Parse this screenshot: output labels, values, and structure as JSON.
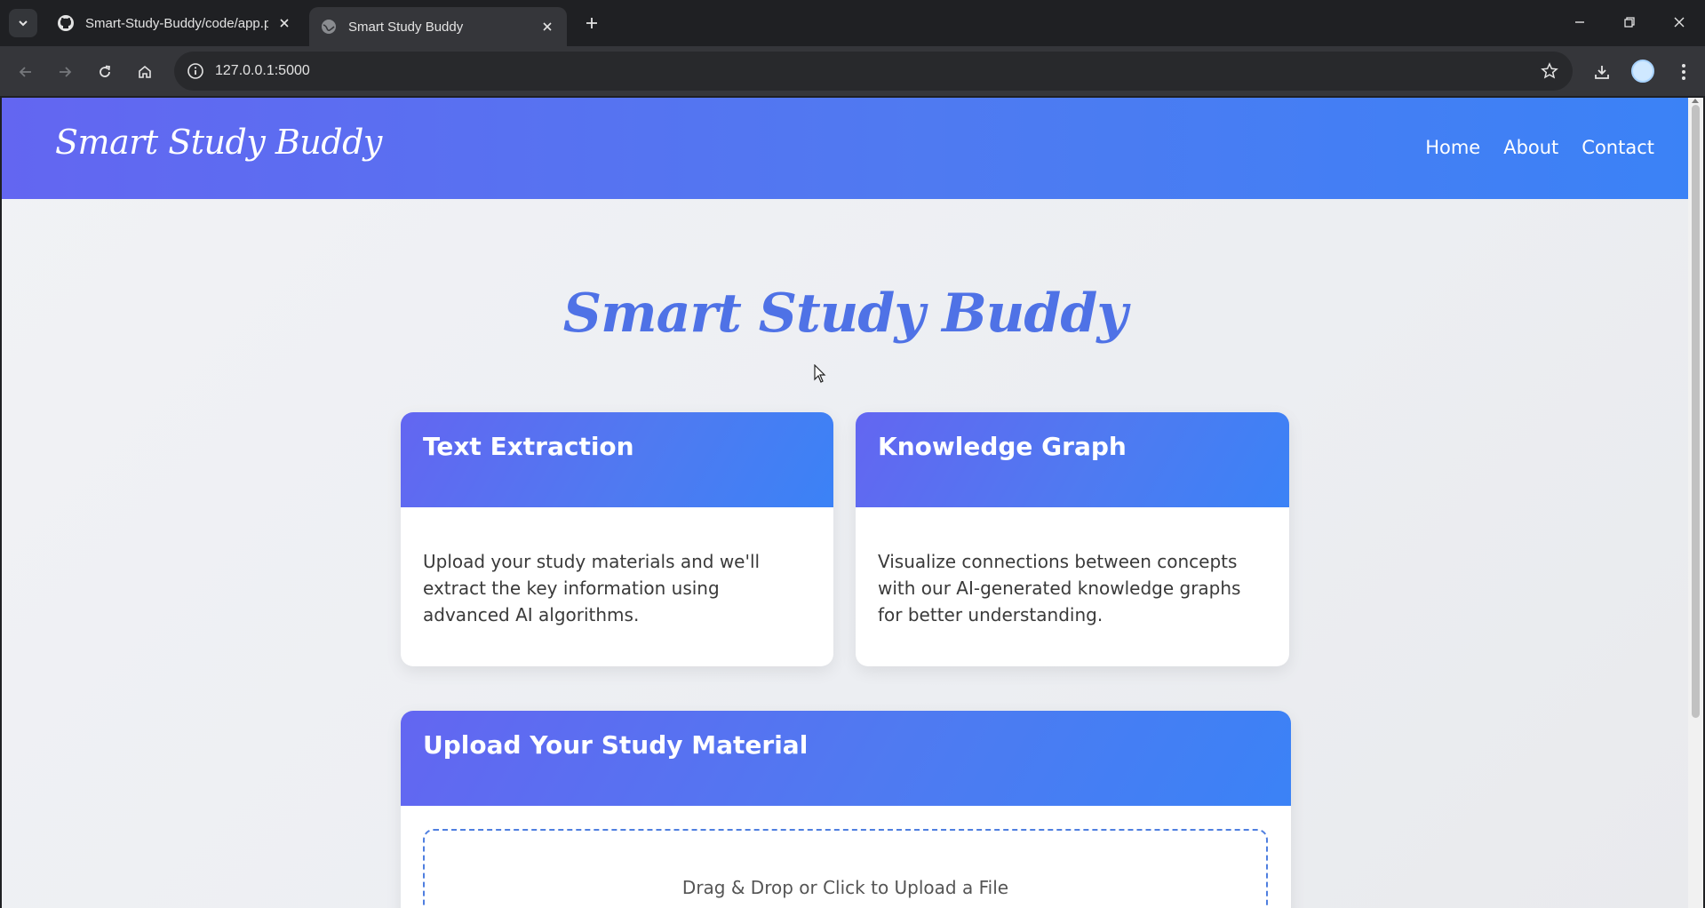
{
  "browser": {
    "tabs": [
      {
        "title": "Smart-Study-Buddy/code/app.p",
        "icon": "github-icon"
      },
      {
        "title": "Smart Study Buddy",
        "icon": "globe-icon"
      }
    ],
    "url": "127.0.0.1:5000"
  },
  "site": {
    "brand": "Smart Study Buddy",
    "nav": [
      "Home",
      "About",
      "Contact"
    ],
    "hero_title": "Smart Study Buddy",
    "cards": [
      {
        "title": "Text Extraction",
        "body": "Upload your study materials and we'll extract the key information using advanced AI algorithms."
      },
      {
        "title": "Knowledge Graph",
        "body": "Visualize connections between concepts with our AI-generated knowledge graphs for better understanding."
      }
    ],
    "upload": {
      "title": "Upload Your Study Material",
      "dropzone_text": "Drag & Drop or Click to Upload a File"
    }
  },
  "colors": {
    "header_gradient_start": "#6366f1",
    "header_gradient_end": "#3b82f6",
    "hero_title": "#4f72e6",
    "dropzone_border": "#4f7fe0"
  }
}
